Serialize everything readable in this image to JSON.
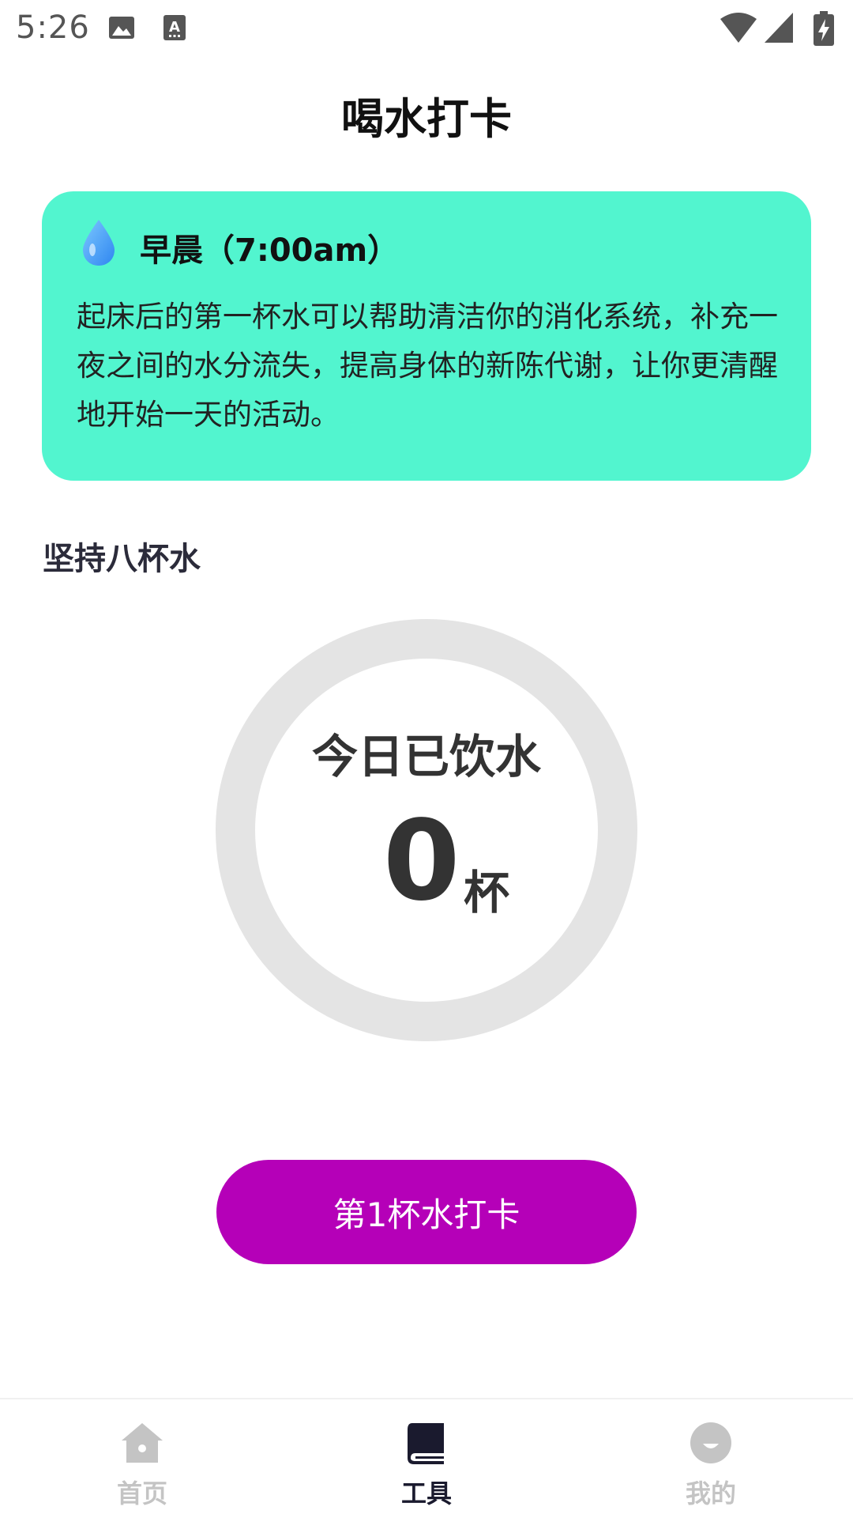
{
  "status_bar": {
    "time": "5:26",
    "left_icons": [
      "image-icon",
      "text-icon"
    ],
    "right_icons": [
      "wifi-icon",
      "cellular-icon",
      "battery-charging-icon"
    ]
  },
  "header": {
    "title": "喝水打卡"
  },
  "tip_card": {
    "icon": "water-drop-icon",
    "title": "早晨（7:00am）",
    "body": "起床后的第一杯水可以帮助清洁你的消化系统，补充一夜之间的水分流失，提高身体的新陈代谢，让你更清醒地开始一天的活动。",
    "color": "#52f5cf"
  },
  "goal": {
    "label": "坚持八杯水"
  },
  "progress": {
    "label": "今日已饮水",
    "count": "0",
    "unit": "杯",
    "fraction": 0,
    "track_color": "#e4e4e4"
  },
  "checkin": {
    "label": "第1杯水打卡",
    "color": "#b500b8"
  },
  "bottom_nav": {
    "items": [
      {
        "label": "首页",
        "icon": "home-icon",
        "active": false
      },
      {
        "label": "工具",
        "icon": "book-icon",
        "active": true
      },
      {
        "label": "我的",
        "icon": "profile-icon",
        "active": false
      }
    ],
    "active_color": "#1a1a2e",
    "inactive_color": "#c4c4c4"
  }
}
